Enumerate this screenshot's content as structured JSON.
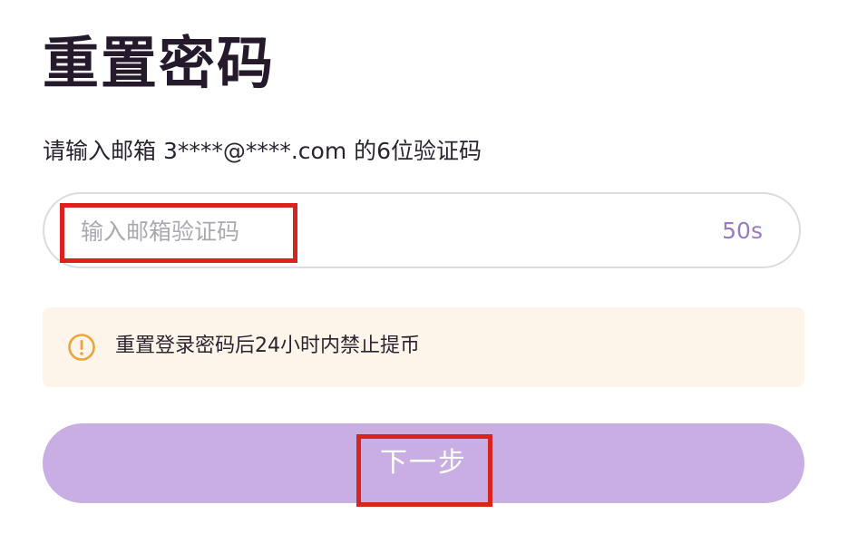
{
  "page": {
    "title": "重置密码",
    "subtitle": "请输入邮箱 3****@****.com 的6位验证码"
  },
  "code_input": {
    "placeholder": "输入邮箱验证码",
    "value": "",
    "countdown": "50s"
  },
  "notice": {
    "icon": "warning-circle-icon",
    "text": "重置登录密码后24小时内禁止提币",
    "icon_color": "#f0a33a",
    "background": "#fdf4ea"
  },
  "next_button": {
    "label": "下一步",
    "background": "#c8aee3"
  },
  "colors": {
    "accent": "#9a7bc4",
    "title": "#241a2c",
    "annotation": "#d9231c"
  }
}
